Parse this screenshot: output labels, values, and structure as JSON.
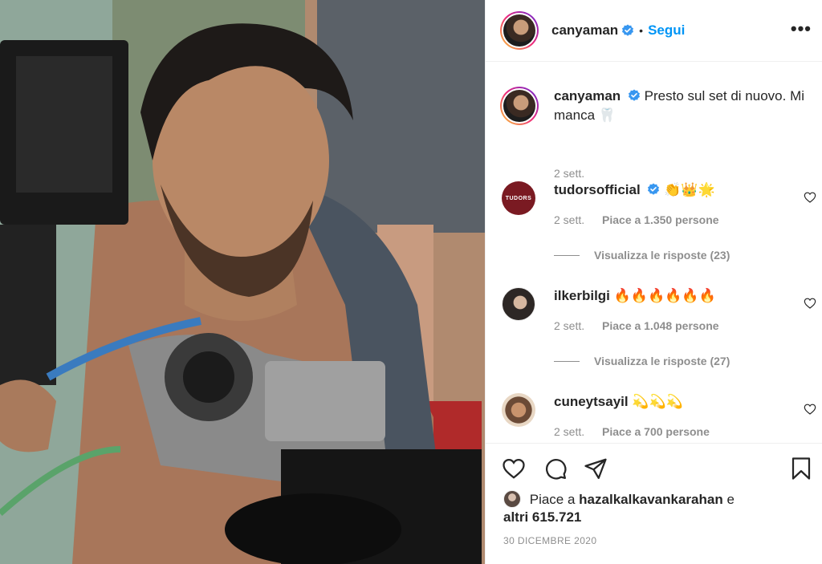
{
  "post": {
    "username": "canyaman",
    "follow_label": "Segui",
    "more_label": "•••"
  },
  "caption": {
    "username": "canyaman",
    "text": "Presto sul set di nuovo. Mi manca 🦷",
    "time": "2 sett."
  },
  "comments": [
    {
      "username": "tudorsofficial",
      "verified": true,
      "avatar_text": "TUDORS",
      "text": "👏👑🌟",
      "time": "2 sett.",
      "likes": "Piace a 1.350 persone",
      "replies": "Visualizza le risposte (23)"
    },
    {
      "username": "ilkerbilgi",
      "verified": false,
      "text": "🔥🔥🔥🔥🔥🔥",
      "time": "2 sett.",
      "likes": "Piace a 1.048 persone",
      "replies": "Visualizza le risposte (27)"
    },
    {
      "username": "cuneytsayil",
      "verified": false,
      "text": "💫💫💫",
      "time": "2 sett.",
      "likes": "Piace a 700 persone"
    }
  ],
  "footer": {
    "likes_prefix": "Piace a",
    "likes_user": "hazalkalkavankarahan",
    "likes_suffix": "e",
    "likes_count": "altri 615.721",
    "date": "30 DICEMBRE 2020"
  },
  "colors": {
    "accent_blue": "#0095f6",
    "verified_blue": "#3897f0",
    "muted": "#8e8e8e",
    "tudors_red": "#7a1a22"
  },
  "icons": [
    "verified-badge-icon",
    "more-options-icon",
    "heart-icon",
    "comment-icon",
    "share-icon",
    "bookmark-icon"
  ]
}
